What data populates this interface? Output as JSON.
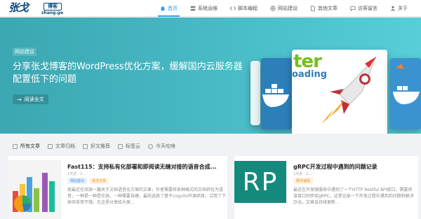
{
  "brand": {
    "script": "张戈",
    "stamp": "博客",
    "domain": "zhang.ge"
  },
  "nav": [
    {
      "label": "首页",
      "icon": "home-icon",
      "active": true
    },
    {
      "label": "系统运维",
      "icon": "server-icon",
      "active": false
    },
    {
      "label": "脚本编程",
      "icon": "code-icon",
      "active": false
    },
    {
      "label": "网站建设",
      "icon": "globe-icon",
      "active": false
    },
    {
      "label": "其他文章",
      "icon": "file-icon",
      "active": false
    },
    {
      "label": "访客留言",
      "icon": "message-icon",
      "active": false
    },
    {
      "label": "关于",
      "icon": "user-icon",
      "active": false
    }
  ],
  "hero": {
    "tag": "网站建设",
    "title": "分享张戈博客的WordPress优化方案，缓解国内云服务器配置低下的问题",
    "read_label": "阅读全文",
    "card_text_1": "ter",
    "card_text_2": "oading",
    "slides": 3,
    "active_slide": 1
  },
  "tabs": [
    {
      "label": "所有文章",
      "icon": "list-icon"
    },
    {
      "label": "文章归档",
      "icon": "archive-icon"
    },
    {
      "label": "好文推荐",
      "icon": "thumb-icon"
    },
    {
      "label": "标签云",
      "icon": "tag-icon"
    },
    {
      "label": "今天吃啥",
      "icon": "food-icon"
    }
  ],
  "posts": [
    {
      "title": "Fast115：支持私有化部署和即阅读无缝对接的语音合成...",
      "meta": "1天前 · 2...",
      "badges": [
        "网站建设",
        "其他文章"
      ],
      "excerpt": "我最近在阅读一篇关于文档语音化方案的文章，作者需要将各种格式的文档转化为语音，一种是一种是在线，一种需要自建。最后选择了基于cogvito开源项目，试用了下体验非常不错。在这里分享给大家..."
    },
    {
      "title": "gRPC开发过程中遇到的问题记录",
      "meta": "1月前 · 2...",
      "badges": [
        "脚本编程"
      ],
      "thumb_text": "RP",
      "excerpt": "最近在开发微服务中遇到了一个HTTP Restful API接口，需要将该接口同步给gRPC，这里记录一下开发过程中遇到的问题和解决办法。文章会持续更新..."
    }
  ],
  "colors": {
    "accent": "#2aa0e6",
    "hero_start": "#3ba7b2",
    "hero_end": "#56cfd8",
    "rp_thumb": "#148a7d"
  }
}
